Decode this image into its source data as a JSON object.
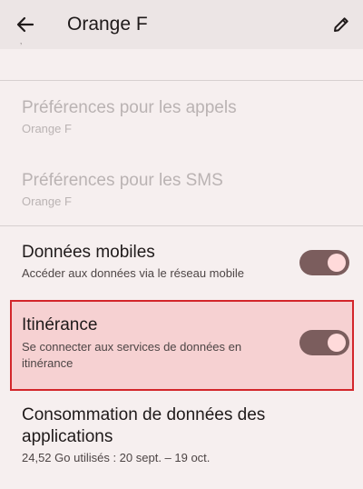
{
  "app_bar": {
    "title": "Orange F",
    "back_icon": "arrow-back-icon",
    "edit_icon": "pencil-icon"
  },
  "settings": {
    "call_prefs": {
      "title": "Préférences pour les appels",
      "subtitle": "Orange F"
    },
    "sms_prefs": {
      "title": "Préférences pour les SMS",
      "subtitle": "Orange F"
    },
    "mobile_data": {
      "title": "Données mobiles",
      "subtitle": "Accéder aux données via le réseau mobile",
      "enabled": true
    },
    "roaming": {
      "title": "Itinérance",
      "subtitle_line1": "Se connecter aux services de données en",
      "subtitle_line2": "itinérance",
      "enabled": true
    },
    "app_data_usage": {
      "title_line1": "Consommation de données des",
      "title_line2": "applications",
      "subtitle": "24,52 Go utilisés : 20 sept. – 19 oct."
    }
  },
  "colors": {
    "highlight_border": "#d3262b",
    "highlight_fill": "#f6d1d2",
    "toggle_on_track": "#7b5d5d",
    "toggle_on_knob": "#ffdada"
  }
}
